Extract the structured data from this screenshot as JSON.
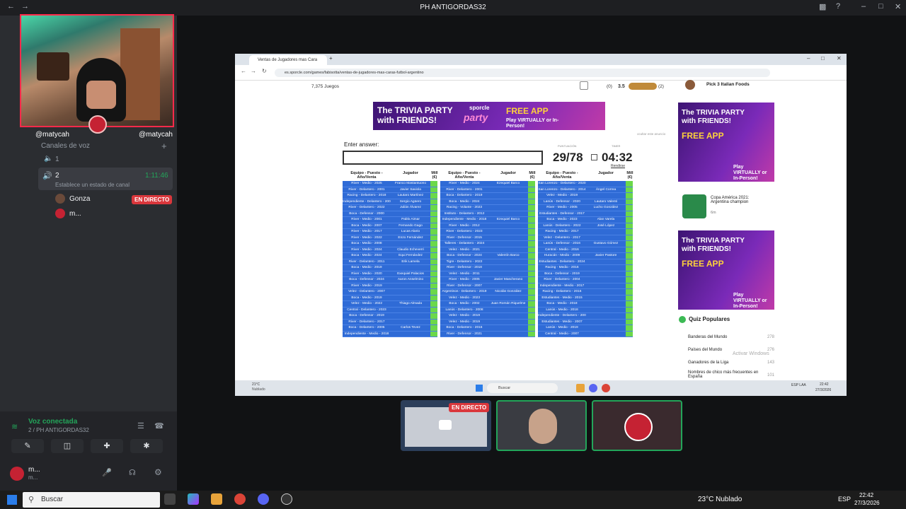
{
  "app": {
    "title": "PH ANTIGORDAS32"
  },
  "sidebar": {
    "cam_names": [
      "@matycah",
      "@matycah"
    ],
    "section": "Canales de voz",
    "channel_1": "1",
    "channel_2": "2",
    "channel_2_timer": "1:11:46",
    "status_hint": "Establece un estado de canal",
    "users": [
      {
        "name": "Gonza",
        "live": "EN DIRECTO"
      },
      {
        "name": "m..."
      }
    ]
  },
  "voice": {
    "status": "Voz conectada",
    "channel": "2 / PH ANTIGORDAS32",
    "user": "m...",
    "user_sub": "m..."
  },
  "browser": {
    "tab_title": "Ventas de Jugadores mas Cara",
    "url": "es.sporcle.com/games/fabisotta/ventas-de-jugadores-mas-caras-futbol-argentino",
    "games_count": "7,375 Juegos",
    "rating": "3.5",
    "counts": [
      "(0)",
      "(2)"
    ]
  },
  "ad": {
    "line1": "The TRIVIA PARTY",
    "line2": "with FRIENDS!",
    "brand": "sporcle",
    "party": "party",
    "app": "FREE APP",
    "sub": "Play VIRTUALLY or In-Person!"
  },
  "quiz": {
    "enter_label": "Enter answer:",
    "score": "29/78",
    "timer": "04:32",
    "score_label": "PUNTUACIÓN",
    "timer_label": "TIMER",
    "giveup": "Rendirse",
    "hide_ad": "ocultar este anuncio",
    "col_headers": [
      "Equipo - Puesto - Año/Venta",
      "Jugador",
      "Mill (€)"
    ],
    "col1": [
      [
        "River - Medio - 2025",
        "Franco Mastantuono"
      ],
      [
        "River - Delantero - 2001",
        "Javier Saviola"
      ],
      [
        "Racing - Delantero - 2018",
        "Lautaro Martínez"
      ],
      [
        "Independiente - Delantero - 2005",
        "Sergio Agüero"
      ],
      [
        "River - Delantero - 2022",
        "Julián Álvarez"
      ],
      [
        "Boca - Defensor - 2000",
        ""
      ],
      [
        "River - Medio - 2001",
        "Pablo Aimar"
      ],
      [
        "Boca - Medio - 2007",
        "Fernando Gago"
      ],
      [
        "River - Medio - 2017",
        "Lucas Alario"
      ],
      [
        "River - Medio - 2022",
        "Enzo Fernández"
      ],
      [
        "Boca - Medio - 2008",
        ""
      ],
      [
        "River - Medio - 2024",
        "Claudio Echeverri"
      ],
      [
        "Boca - Medio - 2024",
        "Equi Fernández"
      ],
      [
        "River - Delantero - 2011",
        "Erik Lamela"
      ],
      [
        "Boca - Medio - 2019",
        ""
      ],
      [
        "River - Medio - 2020",
        "Exequiel Palacios"
      ],
      [
        "Boca - Defensor - 2024",
        "Aaron Anselmino"
      ],
      [
        "River - Medio - 2019",
        ""
      ],
      [
        "Velez - Delantero - 2007",
        ""
      ],
      [
        "Boca - Medio - 2019",
        ""
      ],
      [
        "Velez - Medio - 2022",
        "Thiago Almada"
      ],
      [
        "Central - Delantero - 2023",
        ""
      ],
      [
        "Boca - Defensor - 2019",
        ""
      ],
      [
        "River - Delantero - 2017",
        ""
      ],
      [
        "Boca - Delantero - 2005",
        "Carlos Tevez"
      ],
      [
        "Independiente - Medio - 2018",
        ""
      ]
    ],
    "col2": [
      [
        "River - Medio - 2024",
        "Ezequiel Barco"
      ],
      [
        "River - Delantero - 2001",
        ""
      ],
      [
        "Boca - Delantero - 2019",
        ""
      ],
      [
        "Boca - Medio - 2024",
        ""
      ],
      [
        "Racing - Volante - 2023",
        ""
      ],
      [
        "Instituto - Delantero - 2012",
        ""
      ],
      [
        "Independiente - Medio - 2018",
        "Ezequiel Barco"
      ],
      [
        "River - Medio - 2012",
        ""
      ],
      [
        "River - Delantero - 2023",
        ""
      ],
      [
        "River - Defensor - 2015",
        ""
      ],
      [
        "Talleres - Delantero - 2024",
        ""
      ],
      [
        "Velez - Medio - 2021",
        ""
      ],
      [
        "Boca - Defensor - 2024",
        "Valentín Barco"
      ],
      [
        "Tigre - Delantero - 2022",
        ""
      ],
      [
        "River - Defensor - 2018",
        ""
      ],
      [
        "Velez - Medio - 2011",
        ""
      ],
      [
        "River - Medio - 2005",
        "Javier Mascherano"
      ],
      [
        "River - Defensor - 2007",
        ""
      ],
      [
        "Argentinos - Delantero - 2019",
        "Nicolás González"
      ],
      [
        "Velez - Medio - 2023",
        ""
      ],
      [
        "Boca - Medio - 2002",
        "Juan Román Riquelme"
      ],
      [
        "Lanús - Delantero - 2008",
        ""
      ],
      [
        "Velez - Medio - 2019",
        ""
      ],
      [
        "Velez - Medio - 2019",
        ""
      ],
      [
        "Boca - Delantero - 2016",
        ""
      ],
      [
        "River - Defensor - 2021",
        ""
      ]
    ],
    "col3": [
      [
        "San Lorenzo - Delantero - 2020",
        ""
      ],
      [
        "San Lorenzo - Delantero - 2014",
        "Ángel Correa"
      ],
      [
        "Velez - Medio - 2019",
        ""
      ],
      [
        "Lanús - Defensor - 2020",
        "Lautaro Valenti"
      ],
      [
        "River - Medio - 2005",
        "Lucho González"
      ],
      [
        "Estudiantes - Defensor - 2017",
        ""
      ],
      [
        "Boca - Medio - 2023",
        "Alan Varela"
      ],
      [
        "Lanús - Delantero - 2022",
        "José López"
      ],
      [
        "Racing - Medio - 2017",
        ""
      ],
      [
        "Velez - Delantero - 2017",
        ""
      ],
      [
        "Lanús - Defensor - 2016",
        "Gustavo Gómez"
      ],
      [
        "Central - Medio - 2016",
        ""
      ],
      [
        "Huracán - Medio - 2009",
        "Javier Pastore"
      ],
      [
        "Estudiantes - Delantero - 2024",
        ""
      ],
      [
        "Racing - Medio - 2016",
        ""
      ],
      [
        "Boca - Defensor - 2019",
        ""
      ],
      [
        "River - Delantero - 2004",
        ""
      ],
      [
        "Independiente - Medio - 2017",
        ""
      ],
      [
        "Racing - Delantero - 2016",
        ""
      ],
      [
        "Estudiantes - Medio - 2015",
        ""
      ],
      [
        "Boca - Medio - 2018",
        ""
      ],
      [
        "Lanús - Medio - 2018",
        ""
      ],
      [
        "Independiente - Delantero - 2008",
        ""
      ],
      [
        "Estudiantes - Medio - 2007",
        ""
      ],
      [
        "Lanús - Medio - 2019",
        ""
      ],
      [
        "Central - Medio - 2007",
        ""
      ]
    ]
  },
  "right": {
    "top_item": "Pick 3 Italian Foods",
    "news_title": "Copa América 2021: Argentina champion",
    "news_meta": "6m",
    "popular_title": "Quiz Populares",
    "popular": [
      [
        "Banderas del Mundo",
        "278"
      ],
      [
        "Países del Mundo",
        "276"
      ],
      [
        "Ganadores de la Liga",
        "143"
      ],
      [
        "Nombres de chico más frecuentes en España",
        "101"
      ]
    ],
    "watermark": "Activar Windows"
  },
  "stream_taskbar": {
    "weather": "21°C",
    "weather_sub": "Nublado",
    "search": "Buscar",
    "lang": "ESP LAA",
    "time": "22:42",
    "date": "27/3/2026"
  },
  "thumbs": {
    "live": "EN DIRECTO"
  },
  "taskbar": {
    "search": "Buscar",
    "weather": "23°C Nublado",
    "lang": "ESP",
    "time": "22:42",
    "date": "27/3/2026"
  },
  "colors": {
    "accent": "#da373c",
    "blue": "#2f6bd6",
    "green": "#6bd84a"
  }
}
